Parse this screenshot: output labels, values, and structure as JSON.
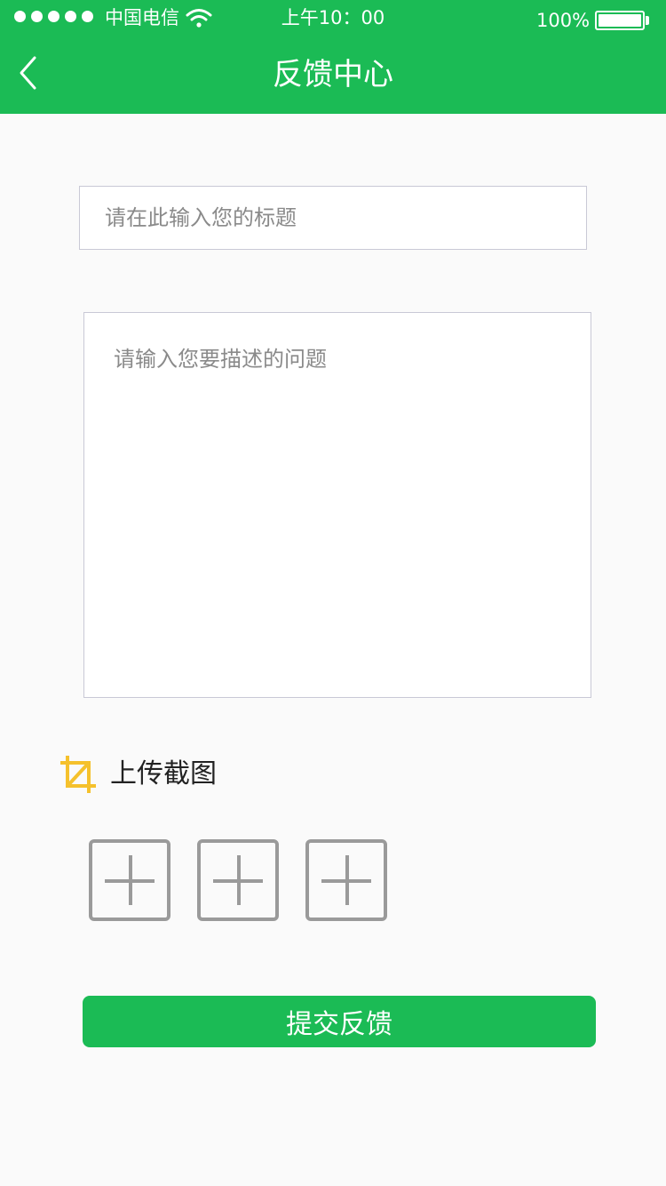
{
  "status_bar": {
    "carrier": "中国电信",
    "time": "上午10：00",
    "battery": "100%"
  },
  "nav": {
    "title": "反馈中心"
  },
  "form": {
    "title_placeholder": "请在此输入您的标题",
    "description_placeholder": "请输入您要描述的问题",
    "upload_label": "上传截图",
    "submit_label": "提交反馈"
  },
  "colors": {
    "primary": "#1bbb55",
    "icon_accent": "#f5c12c",
    "add_border": "#9a9a9a"
  },
  "icons": [
    "back-chevron-icon",
    "crop-icon",
    "wifi-icon",
    "battery-icon",
    "plus-icon"
  ]
}
